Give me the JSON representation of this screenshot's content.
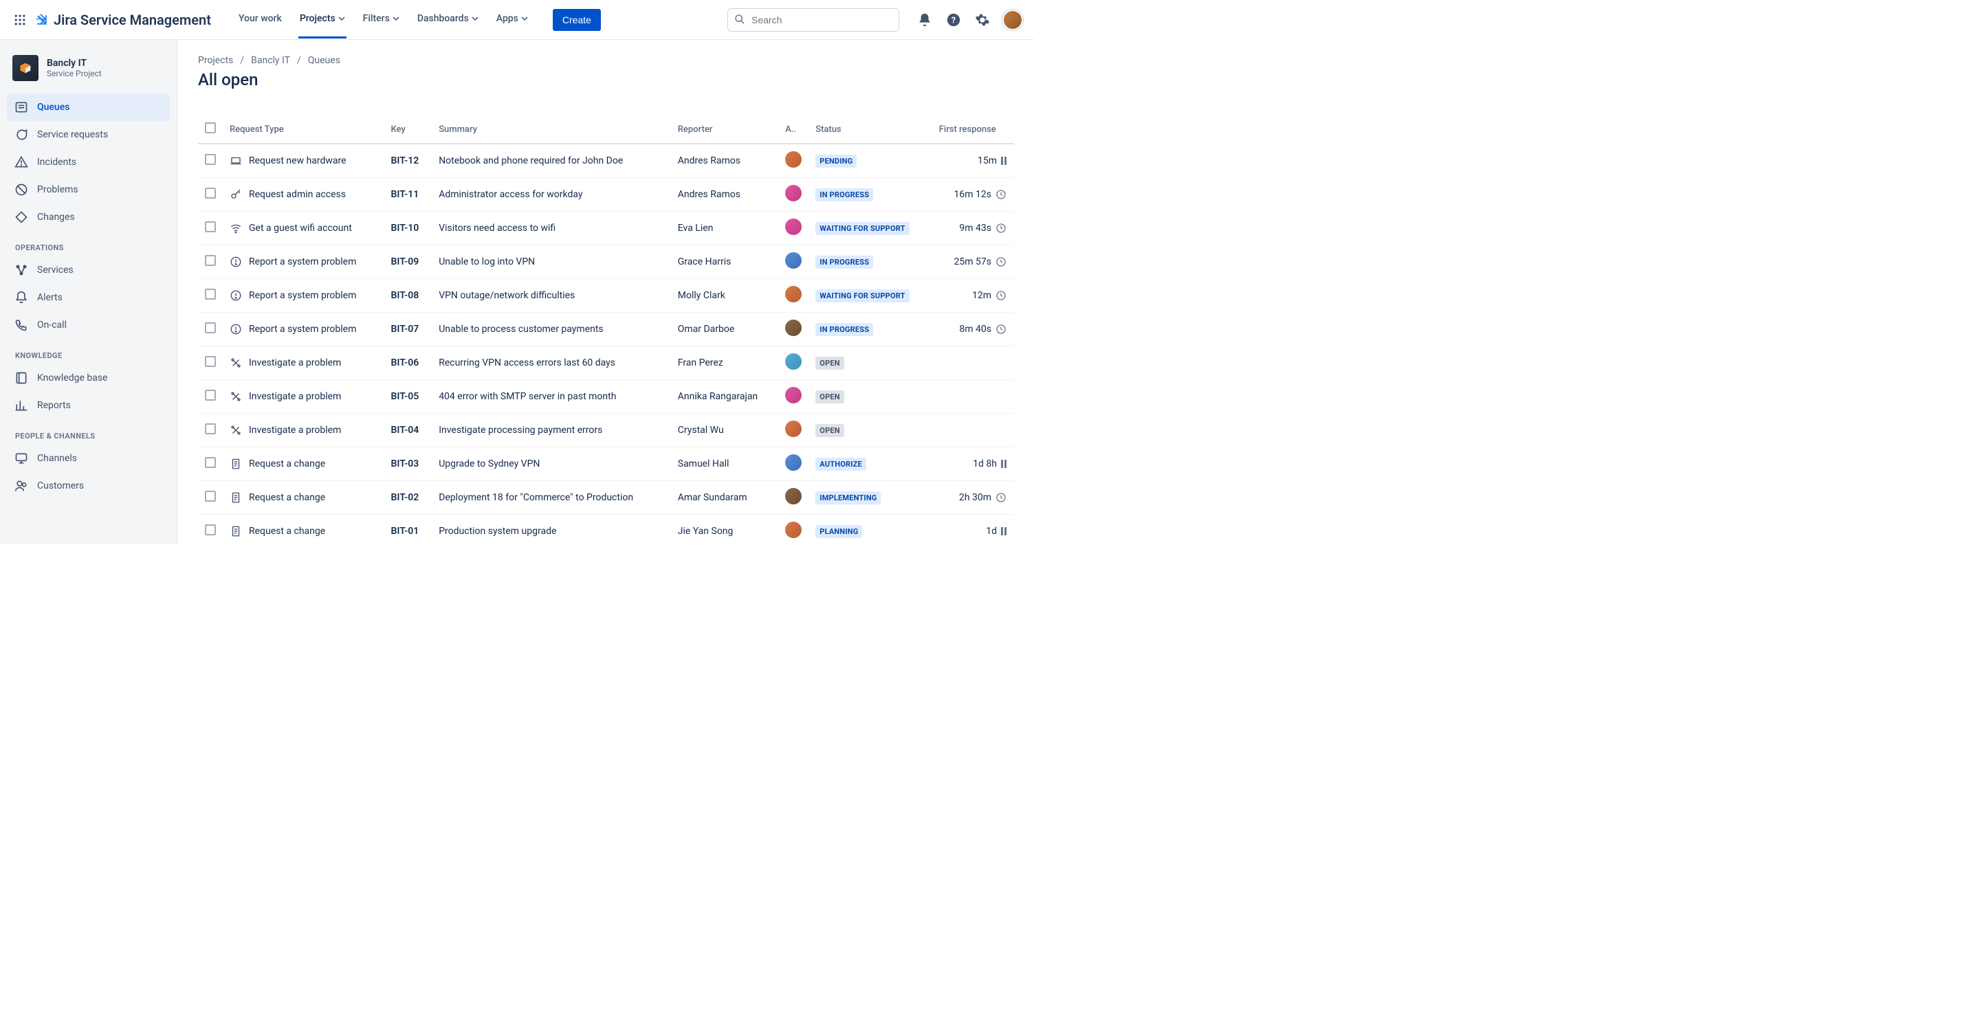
{
  "header": {
    "product_name": "Jira Service Management",
    "nav": {
      "your_work": "Your work",
      "projects": "Projects",
      "filters": "Filters",
      "dashboards": "Dashboards",
      "apps": "Apps"
    },
    "create_label": "Create",
    "search_placeholder": "Search"
  },
  "sidebar": {
    "project_name": "Bancly IT",
    "project_sub": "Service Project",
    "items_main": [
      {
        "label": "Queues",
        "icon": "queue-icon",
        "active": true
      },
      {
        "label": "Service requests",
        "icon": "chat-icon"
      },
      {
        "label": "Incidents",
        "icon": "warning-icon"
      },
      {
        "label": "Problems",
        "icon": "blocked-icon"
      },
      {
        "label": "Changes",
        "icon": "change-icon"
      }
    ],
    "group_ops_title": "OPERATIONS",
    "items_ops": [
      {
        "label": "Services",
        "icon": "services-icon"
      },
      {
        "label": "Alerts",
        "icon": "bell-icon"
      },
      {
        "label": "On-call",
        "icon": "phone-icon"
      }
    ],
    "group_knowledge_title": "KNOWLEDGE",
    "items_knowledge": [
      {
        "label": "Knowledge base",
        "icon": "book-icon"
      },
      {
        "label": "Reports",
        "icon": "chart-icon"
      }
    ],
    "group_people_title": "PEOPLE & CHANNELS",
    "items_people": [
      {
        "label": "Channels",
        "icon": "monitor-icon"
      },
      {
        "label": "Customers",
        "icon": "users-icon"
      }
    ]
  },
  "breadcrumb": {
    "a": "Projects",
    "b": "Bancly IT",
    "c": "Queues"
  },
  "page_title": "All open",
  "columns": {
    "request_type": "Request Type",
    "key": "Key",
    "summary": "Summary",
    "reporter": "Reporter",
    "assignee": "A..",
    "status": "Status",
    "first_response": "First response"
  },
  "rows": [
    {
      "type": "Request new hardware",
      "type_icon": "hardware-icon",
      "key": "BIT-12",
      "summary": "Notebook and phone required for John Doe",
      "reporter": "Andres Ramos",
      "av": "av1",
      "status": "PENDING",
      "status_cls": "pending",
      "fr": "15m",
      "fr_icon": "pause"
    },
    {
      "type": "Request admin access",
      "type_icon": "key-icon",
      "key": "BIT-11",
      "summary": "Administrator access for workday",
      "reporter": "Andres Ramos",
      "av": "av2",
      "status": "IN PROGRESS",
      "status_cls": "in_progress",
      "fr": "16m 12s",
      "fr_icon": "clock"
    },
    {
      "type": "Get a guest wifi account",
      "type_icon": "wifi-icon",
      "key": "BIT-10",
      "summary": "Visitors need access to wifi",
      "reporter": "Eva Lien",
      "av": "av2",
      "status": "WAITING FOR SUPPORT",
      "status_cls": "waiting_for_support",
      "fr": "9m 43s",
      "fr_icon": "clock"
    },
    {
      "type": "Report a system problem",
      "type_icon": "alert-icon",
      "key": "BIT-09",
      "summary": "Unable to log into VPN",
      "reporter": "Grace Harris",
      "av": "av3",
      "status": "IN PROGRESS",
      "status_cls": "in_progress",
      "fr": "25m 57s",
      "fr_icon": "clock"
    },
    {
      "type": "Report a system problem",
      "type_icon": "alert-icon",
      "key": "BIT-08",
      "summary": "VPN outage/network difficulties",
      "reporter": "Molly Clark",
      "av": "av1",
      "status": "WAITING FOR SUPPORT",
      "status_cls": "waiting_for_support",
      "fr": "12m",
      "fr_icon": "clock"
    },
    {
      "type": "Report a system problem",
      "type_icon": "alert-icon",
      "key": "BIT-07",
      "summary": "Unable to process customer payments",
      "reporter": "Omar Darboe",
      "av": "av4",
      "status": "IN PROGRESS",
      "status_cls": "in_progress",
      "fr": "8m 40s",
      "fr_icon": "clock"
    },
    {
      "type": "Investigate a problem",
      "type_icon": "tools-icon",
      "key": "BIT-06",
      "summary": "Recurring VPN access errors last 60 days",
      "reporter": "Fran Perez",
      "av": "av5",
      "status": "OPEN",
      "status_cls": "open",
      "fr": "",
      "fr_icon": ""
    },
    {
      "type": "Investigate a problem",
      "type_icon": "tools-icon",
      "key": "BIT-05",
      "summary": "404 error with SMTP server in past month",
      "reporter": "Annika Rangarajan",
      "av": "av2",
      "status": "OPEN",
      "status_cls": "open",
      "fr": "",
      "fr_icon": ""
    },
    {
      "type": "Investigate a problem",
      "type_icon": "tools-icon",
      "key": "BIT-04",
      "summary": "Investigate processing payment errors",
      "reporter": "Crystal Wu",
      "av": "av1",
      "status": "OPEN",
      "status_cls": "open",
      "fr": "",
      "fr_icon": ""
    },
    {
      "type": "Request a change",
      "type_icon": "doc-icon",
      "key": "BIT-03",
      "summary": "Upgrade to Sydney VPN",
      "reporter": "Samuel Hall",
      "av": "av3",
      "status": "AUTHORIZE",
      "status_cls": "authorize",
      "fr": "1d 8h",
      "fr_icon": "pause"
    },
    {
      "type": "Request a change",
      "type_icon": "doc-icon",
      "key": "BIT-02",
      "summary": "Deployment 18 for \"Commerce\" to Production",
      "reporter": "Amar Sundaram",
      "av": "av4",
      "status": "IMPLEMENTING",
      "status_cls": "implementing",
      "fr": "2h 30m",
      "fr_icon": "clock"
    },
    {
      "type": "Request a change",
      "type_icon": "doc-icon",
      "key": "BIT-01",
      "summary": "Production system upgrade",
      "reporter": "Jie Yan Song",
      "av": "av1",
      "status": "PLANNING",
      "status_cls": "planning",
      "fr": "1d",
      "fr_icon": "pause"
    }
  ]
}
